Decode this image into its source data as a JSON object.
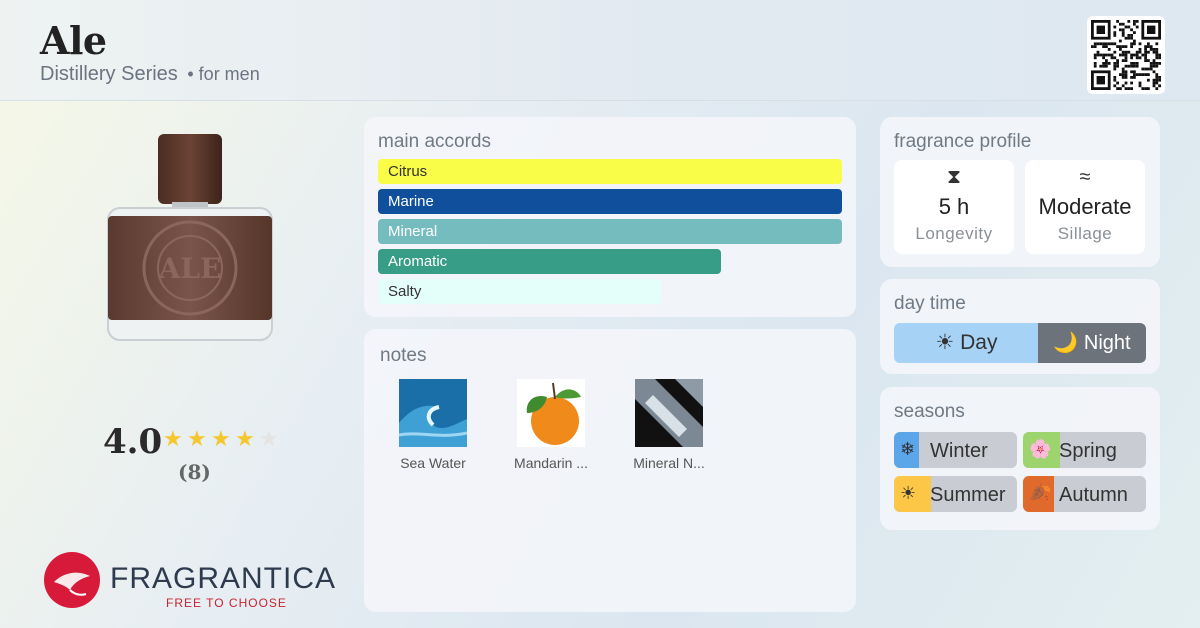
{
  "header": {
    "title": "Ale",
    "subtitle": "Distillery Series",
    "gender": "• for men"
  },
  "rating": {
    "value": "4.0",
    "count": "(8)",
    "stars_filled": 4,
    "stars_total": 5
  },
  "logo": {
    "brand": "FRAGRANTICA",
    "tagline": "FREE TO CHOOSE"
  },
  "accords": {
    "title": "main accords",
    "items": [
      {
        "label": "Citrus",
        "strength": 1.0,
        "color": "#f9fd48",
        "text_color": "#333333"
      },
      {
        "label": "Marine",
        "strength": 1.0,
        "color": "#0f4f9b",
        "text_color": "#ffffff"
      },
      {
        "label": "Mineral",
        "strength": 1.0,
        "color": "#75bcbf",
        "text_color": "#ffffff"
      },
      {
        "label": "Aromatic",
        "strength": 0.74,
        "color": "#379d86",
        "text_color": "#ffffff"
      },
      {
        "label": "Salty",
        "strength": 0.61,
        "color": "#e4fefa",
        "text_color": "#333333"
      }
    ]
  },
  "notes": {
    "title": "notes",
    "items": [
      {
        "label": "Sea Water",
        "icon": "wave-icon"
      },
      {
        "label": "Mandarin ...",
        "icon": "mandarin-icon"
      },
      {
        "label": "Mineral N...",
        "icon": "mineral-icon"
      }
    ]
  },
  "profile": {
    "title": "fragrance profile",
    "longevity": {
      "value": "5 h",
      "label": "Longevity",
      "icon": "hourglass-icon",
      "glyph": "⧗"
    },
    "sillage": {
      "value": "Moderate",
      "label": "Sillage",
      "icon": "waves-icon",
      "glyph": "≈"
    }
  },
  "daytime": {
    "title": "day time",
    "day": "☀ Day",
    "night": "🌙 Night"
  },
  "seasons": {
    "title": "seasons",
    "items": [
      {
        "label": "Winter",
        "icon": "snowflake-icon",
        "glyph": "❄",
        "color": "#5aa6e8",
        "level": 0.2
      },
      {
        "label": "Spring",
        "icon": "flower-icon",
        "glyph": "🌸",
        "color": "#9dd46e",
        "level": 0.3
      },
      {
        "label": "Summer",
        "icon": "sun-icon",
        "glyph": "☀",
        "color": "#fcc646",
        "level": 0.3
      },
      {
        "label": "Autumn",
        "icon": "leaf-icon",
        "glyph": "🍂",
        "color": "#e06a2b",
        "level": 0.25
      }
    ]
  }
}
